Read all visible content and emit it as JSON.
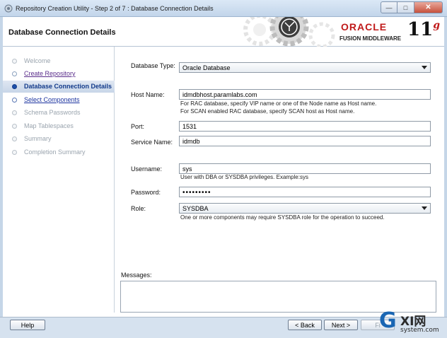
{
  "window": {
    "title": "Repository Creation Utility - Step 2 of 7 : Database Connection Details",
    "controls": [
      "minimize",
      "maximize",
      "close"
    ]
  },
  "header": {
    "page_title": "Database Connection Details",
    "oracle_brand": "ORACLE",
    "product": "FUSION MIDDLEWARE",
    "version": "11",
    "version_suffix": "g"
  },
  "nav": {
    "items": [
      {
        "label": "Welcome",
        "state": "disabled"
      },
      {
        "label": "Create Repository",
        "state": "done"
      },
      {
        "label": "Database Connection Details",
        "state": "current"
      },
      {
        "label": "Select Components",
        "state": "link"
      },
      {
        "label": "Schema Passwords",
        "state": "disabled"
      },
      {
        "label": "Map Tablespaces",
        "state": "disabled"
      },
      {
        "label": "Summary",
        "state": "disabled"
      },
      {
        "label": "Completion Summary",
        "state": "disabled"
      }
    ]
  },
  "form": {
    "database_type": {
      "label": "Database Type:",
      "value": "Oracle Database"
    },
    "host_name": {
      "label": "Host Name:",
      "value": "idmdbhost.paramlabs.com",
      "hint1": "For RAC database, specify VIP name or one of the Node name as Host name.",
      "hint2": "For SCAN enabled RAC database, specify SCAN host as Host name."
    },
    "port": {
      "label": "Port:",
      "value": "1531"
    },
    "service_name": {
      "label": "Service Name:",
      "value": "idmdb"
    },
    "username": {
      "label": "Username:",
      "value": "sys",
      "hint": "User with DBA or SYSDBA privileges. Example:sys"
    },
    "password": {
      "label": "Password:",
      "value": "•••••••••"
    },
    "role": {
      "label": "Role:",
      "value": "SYSDBA",
      "hint": "One or more components may require SYSDBA role for the operation to succeed."
    }
  },
  "messages": {
    "label": "Messages:"
  },
  "buttons": {
    "help": "Help",
    "back": "< Back",
    "next": "Next >",
    "finish": "Fi"
  },
  "watermark": {
    "g": "G",
    "xi": "XI网",
    "sub": "system.com"
  },
  "colors": {
    "accent": "#1d4fa8",
    "oracle_red": "#c01a1a",
    "link": "#1d35a0"
  }
}
